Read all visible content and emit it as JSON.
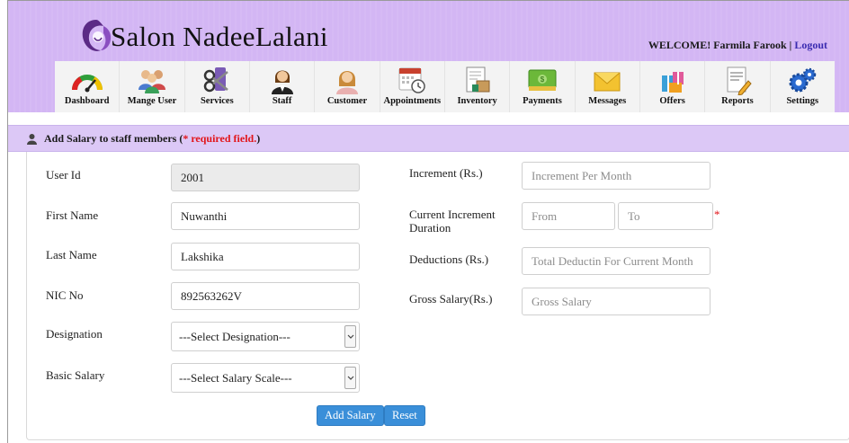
{
  "header": {
    "brand": "Salon NadeeLalani",
    "welcome_prefix": "WELCOME! Farmila Farook",
    "separator": " | ",
    "logout_label": "Logout"
  },
  "nav": [
    {
      "label": "Dashboard",
      "icon": "speedometer-icon"
    },
    {
      "label": "Mange User",
      "icon": "users-icon"
    },
    {
      "label": "Services",
      "icon": "scissors-icon"
    },
    {
      "label": "Staff",
      "icon": "staff-icon"
    },
    {
      "label": "Customer",
      "icon": "customer-icon"
    },
    {
      "label": "Appointments",
      "icon": "calendar-clock-icon"
    },
    {
      "label": "Inventory",
      "icon": "inventory-icon"
    },
    {
      "label": "Payments",
      "icon": "cash-icon"
    },
    {
      "label": "Messages",
      "icon": "envelope-icon"
    },
    {
      "label": "Offers",
      "icon": "gift-icon"
    },
    {
      "label": "Reports",
      "icon": "report-icon"
    },
    {
      "label": "Settings",
      "icon": "gears-icon"
    }
  ],
  "section": {
    "title": "Add Salary to staff members (",
    "required_note": "* required field.",
    "close_paren": ")"
  },
  "form": {
    "user_id": {
      "label": "User Id",
      "value": "2001"
    },
    "first_name": {
      "label": "First Name",
      "value": "Nuwanthi"
    },
    "last_name": {
      "label": "Last Name",
      "value": "Lakshika"
    },
    "nic": {
      "label": "NIC No",
      "value": "892563262V"
    },
    "designation": {
      "label": "Designation",
      "selected": "---Select Designation---"
    },
    "basic_salary": {
      "label": "Basic Salary",
      "selected": "---Select Salary Scale---"
    },
    "increment": {
      "label": "Increment (Rs.)",
      "value": "",
      "placeholder": "Increment Per Month"
    },
    "increment_duration": {
      "label_line1": "Current Increment",
      "label_line2": "Duration",
      "from_placeholder": "From",
      "to_placeholder": "To",
      "required_mark": "*"
    },
    "deductions": {
      "label": "Deductions (Rs.)",
      "value": "",
      "placeholder": "Total Deductin For Current Month"
    },
    "gross_salary": {
      "label": "Gross Salary(Rs.)",
      "value": "",
      "placeholder": "Gross Salary"
    }
  },
  "buttons": {
    "add_salary": "Add Salary",
    "reset": "Reset"
  },
  "colors": {
    "header_bg": "#d3b6f4",
    "section_bg": "#dcc8f6",
    "required": "#e2161b",
    "button": "#3a8fd9"
  }
}
